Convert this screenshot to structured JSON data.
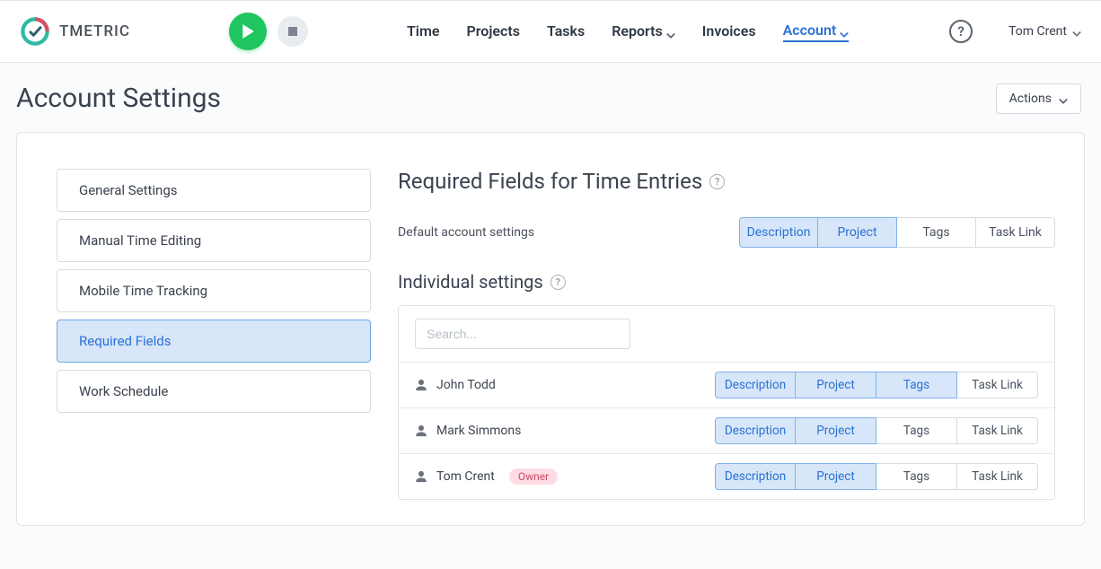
{
  "brand": {
    "name": "TMETRIC"
  },
  "nav": {
    "time": "Time",
    "projects": "Projects",
    "tasks": "Tasks",
    "reports": "Reports",
    "invoices": "Invoices",
    "account": "Account"
  },
  "user": {
    "name": "Tom Crent"
  },
  "page": {
    "title": "Account Settings",
    "actions_label": "Actions"
  },
  "sidebar": {
    "items": [
      {
        "label": "General Settings"
      },
      {
        "label": "Manual Time Editing"
      },
      {
        "label": "Mobile Time Tracking"
      },
      {
        "label": "Required Fields"
      },
      {
        "label": "Work Schedule"
      }
    ]
  },
  "section": {
    "title": "Required Fields for Time Entries",
    "default_label": "Default account settings",
    "individual_title": "Individual settings",
    "search_placeholder": "Search..."
  },
  "fields": {
    "description": "Description",
    "project": "Project",
    "tags": "Tags",
    "tasklink": "Task Link"
  },
  "default_settings": {
    "description": true,
    "project": true,
    "tags": false,
    "tasklink": false
  },
  "members": [
    {
      "name": "John Todd",
      "badge": null,
      "settings": {
        "description": true,
        "project": true,
        "tags": true,
        "tasklink": false
      }
    },
    {
      "name": "Mark Simmons",
      "badge": null,
      "settings": {
        "description": true,
        "project": true,
        "tags": false,
        "tasklink": false
      }
    },
    {
      "name": "Tom Crent",
      "badge": "Owner",
      "settings": {
        "description": true,
        "project": true,
        "tags": false,
        "tasklink": false
      }
    }
  ]
}
